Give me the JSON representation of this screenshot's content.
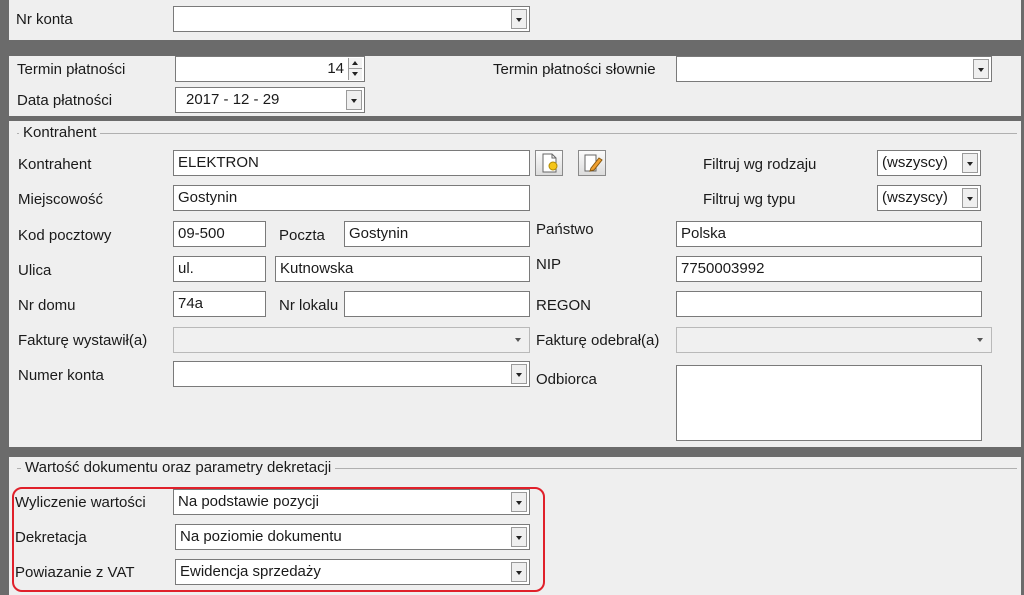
{
  "account_section": {
    "nr_konta_label": "Nr konta",
    "nr_konta_value": ""
  },
  "payment_section": {
    "termin_label": "Termin płatności",
    "termin_value": "14",
    "termin_slownie_label": "Termin płatności słownie",
    "termin_slownie_value": "",
    "data_label": "Data płatności",
    "data_value": "2017 - 12 - 29"
  },
  "kontrahent": {
    "group_title": "Kontrahent",
    "kontrahent_label": "Kontrahent",
    "kontrahent_value": "ELEKTRON",
    "miejscowosc_label": "Miejscowość",
    "miejscowosc_value": "Gostynin",
    "kod_label": "Kod pocztowy",
    "kod_value": "09-500",
    "poczta_label": "Poczta",
    "poczta_value": "Gostynin",
    "ulica_label": "Ulica",
    "ulica_prefix": "ul.",
    "ulica_value": "Kutnowska",
    "nr_domu_label": "Nr domu",
    "nr_domu_value": "74a",
    "nr_lokalu_label": "Nr lokalu",
    "nr_lokalu_value": "",
    "wystawil_label": "Fakturę wystawił(a)",
    "wystawil_value": "",
    "numer_konta_label": "Numer konta",
    "numer_konta_value": "",
    "filtruj_rodzaj_label": "Filtruj wg rodzaju",
    "filtruj_rodzaj_value": "(wszyscy)",
    "filtruj_typ_label": "Filtruj wg typu",
    "filtruj_typ_value": "(wszyscy)",
    "panstwo_label": "Państwo",
    "panstwo_value": "Polska",
    "nip_label": "NIP",
    "nip_value": "7750003992",
    "regon_label": "REGON",
    "regon_value": "",
    "odebral_label": "Fakturę odebrał(a)",
    "odebral_value": "",
    "odbiorca_label": "Odbiorca",
    "odbiorca_value": "",
    "icons": [
      "new-document-icon",
      "edit-document-icon"
    ]
  },
  "wartosc": {
    "group_title": "Wartość dokumentu oraz parametry dekretacji",
    "wyliczenie_label": "Wyliczenie wartości",
    "wyliczenie_value": "Na podstawie pozycji",
    "dekretacja_label": "Dekretacja",
    "dekretacja_value": "Na poziomie dokumentu",
    "powiazanie_label": "Powiazanie z VAT",
    "powiazanie_value": "Ewidencja sprzedaży",
    "highlight_color": "#e0202a"
  },
  "colors": {
    "panel_bg": "#efefef",
    "separator_band": "#6b6b6b"
  }
}
